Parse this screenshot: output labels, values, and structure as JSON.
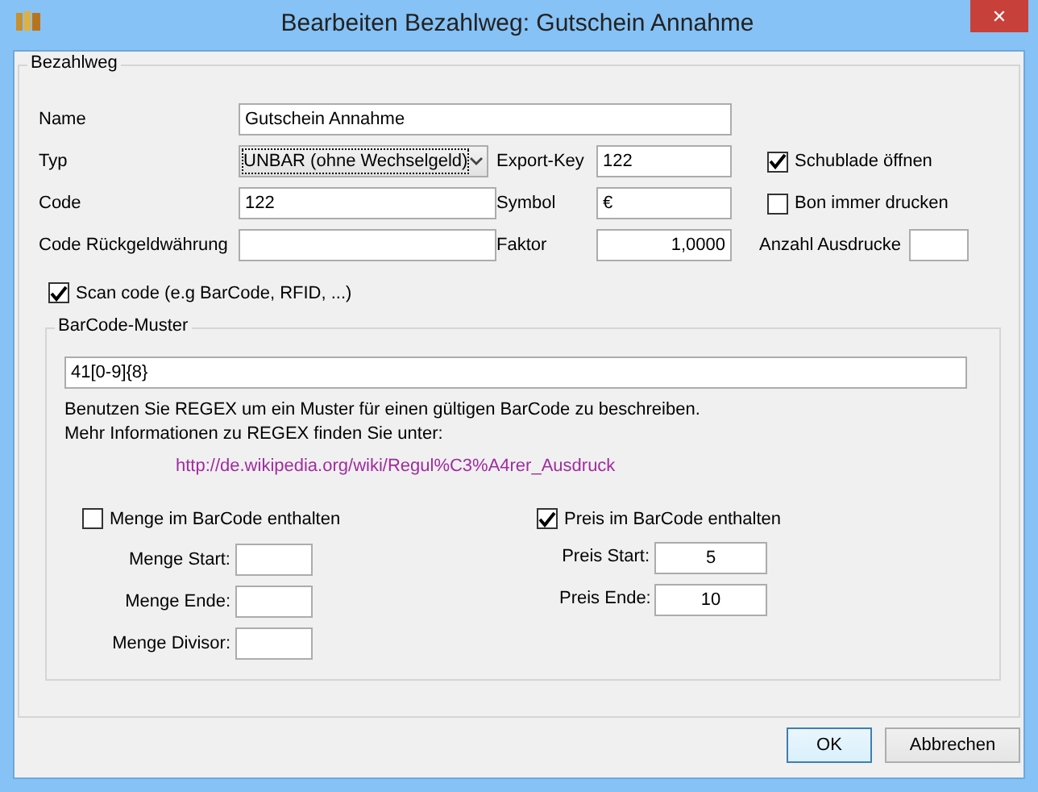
{
  "window": {
    "title": "Bearbeiten Bezahlweg: Gutschein Annahme",
    "close": "✕"
  },
  "bezahlweg": {
    "legend": "Bezahlweg",
    "name": {
      "label": "Name",
      "value": "Gutschein Annahme"
    },
    "typ": {
      "label": "Typ",
      "value": "UNBAR (ohne Wechselgeld)"
    },
    "export_key": {
      "label": "Export-Key",
      "value": "122"
    },
    "schublade": {
      "label": "Schublade öffnen",
      "checked": true
    },
    "code": {
      "label": "Code",
      "value": "122"
    },
    "symbol": {
      "label": "Symbol",
      "value": "€"
    },
    "bon": {
      "label": "Bon immer drucken",
      "checked": false
    },
    "rueckgeld": {
      "label": "Code Rückgeldwährung"
    },
    "faktor": {
      "label": "Faktor",
      "value": "1,0000"
    },
    "ausdrucke": {
      "label": "Anzahl Ausdrucke"
    },
    "scan_code": {
      "label": "Scan code (e.g BarCode, RFID, ...)",
      "checked": true
    },
    "barcode": {
      "legend": "BarCode-Muster",
      "pattern": "41[0-9]{8}",
      "help": [
        "Benutzen Sie REGEX um ein Muster für einen gültigen BarCode zu beschreiben.",
        "Mehr Informationen zu REGEX finden Sie unter:"
      ],
      "link": "http://de.wikipedia.org/wiki/Regul%C3%A4rer_Ausdruck",
      "menge": {
        "label": "Menge im BarCode enthalten",
        "checked": false,
        "fields": [
          {
            "label": "Menge Start:"
          },
          {
            "label": "Menge Ende:"
          },
          {
            "label": "Menge Divisor:"
          }
        ]
      },
      "preis": {
        "label": "Preis im BarCode enthalten",
        "checked": true,
        "fields": [
          {
            "label": "Preis Start:",
            "value": "5"
          },
          {
            "label": "Preis Ende:",
            "value": "10"
          }
        ]
      }
    }
  },
  "buttons": [
    {
      "label": "OK",
      "default": true
    },
    {
      "label": "Abbrechen",
      "default": false
    }
  ]
}
